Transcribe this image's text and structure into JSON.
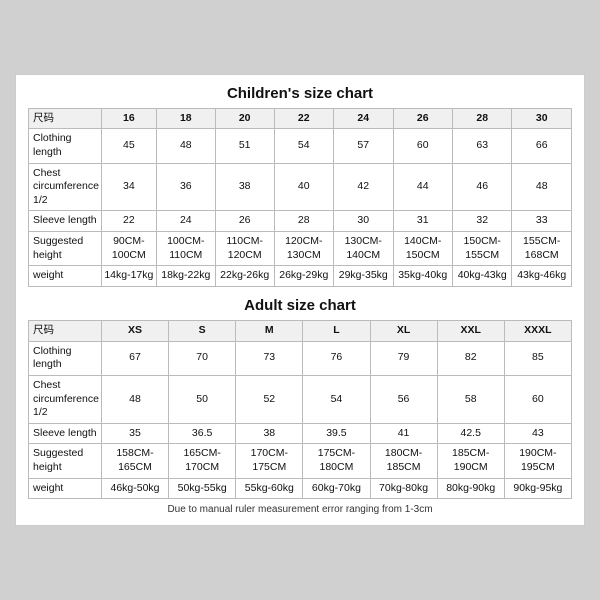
{
  "children_title": "Children's size chart",
  "adult_title": "Adult size chart",
  "footer_note": "Due to manual ruler measurement error ranging from 1-3cm",
  "children_table": {
    "headers": [
      "尺码",
      "16",
      "18",
      "20",
      "22",
      "24",
      "26",
      "28",
      "30"
    ],
    "rows": [
      {
        "label": "Clothing length",
        "values": [
          "45",
          "48",
          "51",
          "54",
          "57",
          "60",
          "63",
          "66"
        ]
      },
      {
        "label": "Chest circumference 1/2",
        "values": [
          "34",
          "36",
          "38",
          "40",
          "42",
          "44",
          "46",
          "48"
        ]
      },
      {
        "label": "Sleeve length",
        "values": [
          "22",
          "24",
          "26",
          "28",
          "30",
          "31",
          "32",
          "33"
        ]
      },
      {
        "label": "Suggested height",
        "values": [
          "90CM-100CM",
          "100CM-110CM",
          "110CM-120CM",
          "120CM-130CM",
          "130CM-140CM",
          "140CM-150CM",
          "150CM-155CM",
          "155CM-168CM"
        ]
      },
      {
        "label": "weight",
        "values": [
          "14kg-17kg",
          "18kg-22kg",
          "22kg-26kg",
          "26kg-29kg",
          "29kg-35kg",
          "35kg-40kg",
          "40kg-43kg",
          "43kg-46kg"
        ]
      }
    ]
  },
  "adult_table": {
    "headers": [
      "尺码",
      "XS",
      "S",
      "M",
      "L",
      "XL",
      "XXL",
      "XXXL"
    ],
    "rows": [
      {
        "label": "Clothing length",
        "values": [
          "67",
          "70",
          "73",
          "76",
          "79",
          "82",
          "85"
        ]
      },
      {
        "label": "Chest circumference 1/2",
        "values": [
          "48",
          "50",
          "52",
          "54",
          "56",
          "58",
          "60"
        ]
      },
      {
        "label": "Sleeve length",
        "values": [
          "35",
          "36.5",
          "38",
          "39.5",
          "41",
          "42.5",
          "43"
        ]
      },
      {
        "label": "Suggested height",
        "values": [
          "158CM-165CM",
          "165CM-170CM",
          "170CM-175CM",
          "175CM-180CM",
          "180CM-185CM",
          "185CM-190CM",
          "190CM-195CM"
        ]
      },
      {
        "label": "weight",
        "values": [
          "46kg-50kg",
          "50kg-55kg",
          "55kg-60kg",
          "60kg-70kg",
          "70kg-80kg",
          "80kg-90kg",
          "90kg-95kg"
        ]
      }
    ]
  }
}
